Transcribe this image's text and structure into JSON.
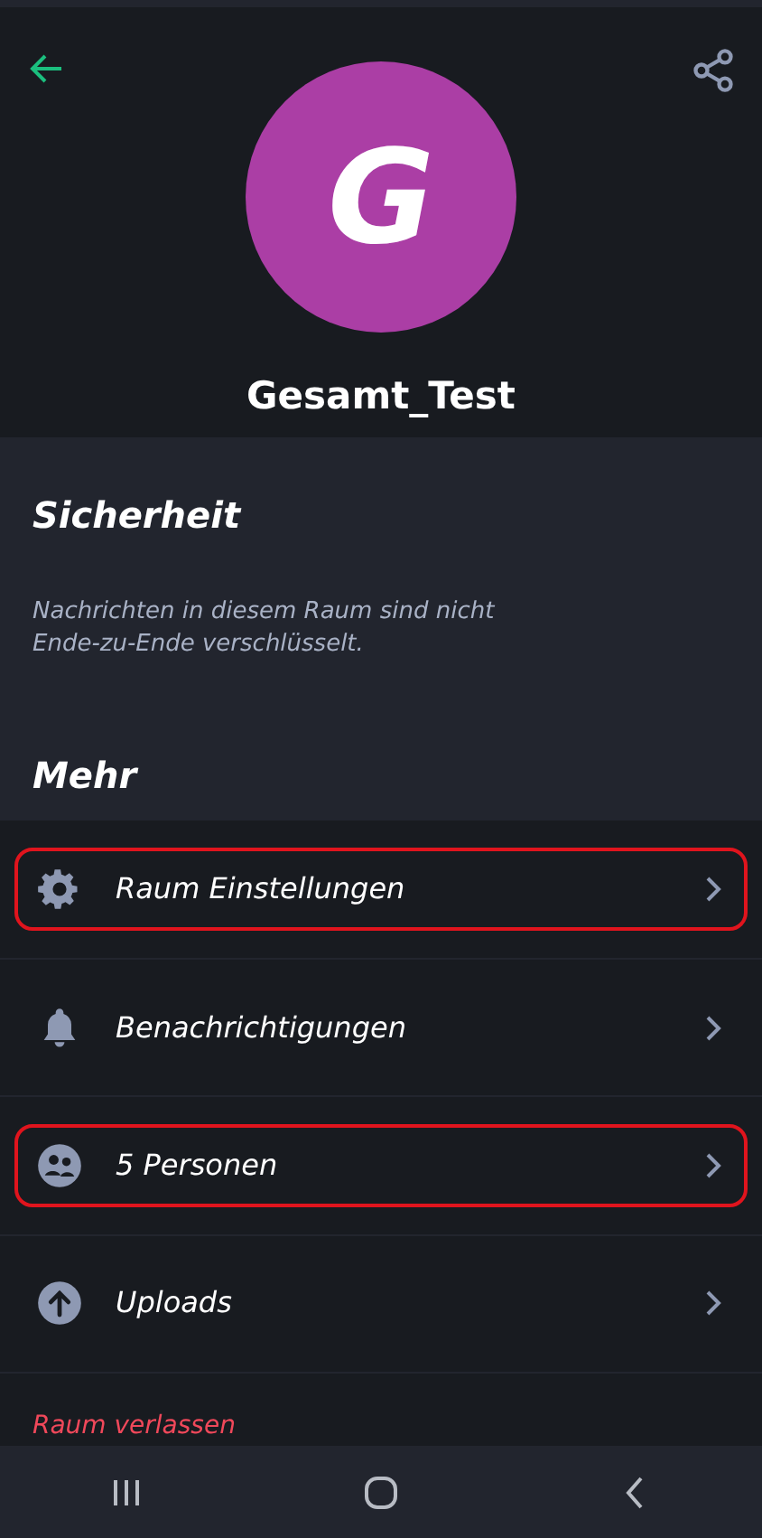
{
  "header": {
    "avatar_letter": "G",
    "color": "#ab3ea5",
    "room_name": "Gesamt_Test"
  },
  "security": {
    "title": "Sicherheit",
    "text": "Nachrichten in diesem Raum sind nicht Ende-zu-Ende verschlüsselt."
  },
  "more": {
    "title": "Mehr"
  },
  "items": [
    {
      "kind": "settings",
      "label": "Raum Einstellungen",
      "highlighted": true
    },
    {
      "kind": "notifications",
      "label": "Benachrichtigungen",
      "highlighted": false
    },
    {
      "kind": "people",
      "label": "5 Personen",
      "highlighted": true
    },
    {
      "kind": "uploads",
      "label": "Uploads",
      "highlighted": false
    }
  ],
  "leave": {
    "label": "Raum verlassen"
  }
}
